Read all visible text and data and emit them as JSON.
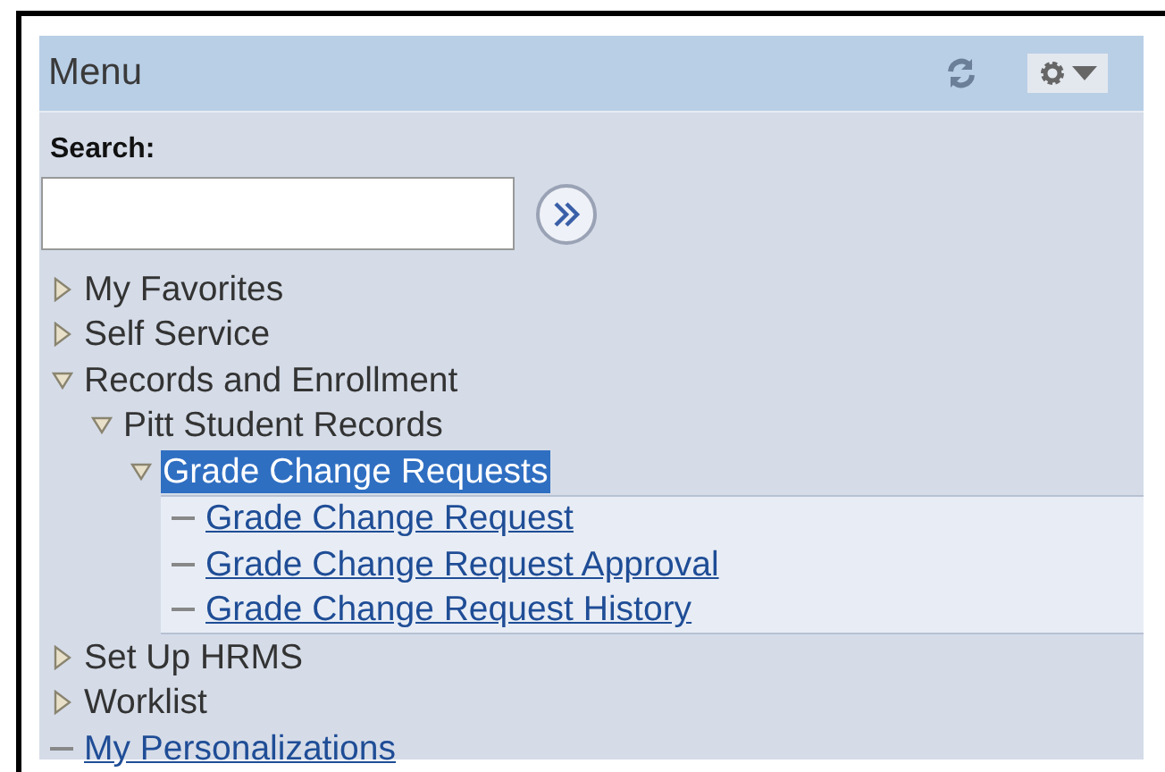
{
  "panel": {
    "title": "Menu"
  },
  "search": {
    "label": "Search:"
  },
  "tree": [
    {
      "label": "My Favorites",
      "kind": "folder",
      "expanded": false,
      "selected": false
    },
    {
      "label": "Self Service",
      "kind": "folder",
      "expanded": false,
      "selected": false
    },
    {
      "label": "Records and Enrollment",
      "kind": "folder",
      "expanded": true,
      "selected": false,
      "children": [
        {
          "label": "Pitt Student Records",
          "kind": "folder",
          "expanded": true,
          "selected": false,
          "children": [
            {
              "label": "Grade Change Requests",
              "kind": "folder",
              "expanded": true,
              "selected": true,
              "children": [
                {
                  "label": "Grade Change Request",
                  "kind": "link",
                  "selected": false
                },
                {
                  "label": "Grade Change Request Approval",
                  "kind": "link",
                  "selected": false
                },
                {
                  "label": "Grade Change Request History",
                  "kind": "link",
                  "selected": false
                }
              ]
            }
          ]
        }
      ]
    },
    {
      "label": "Set Up HRMS",
      "kind": "folder",
      "expanded": false,
      "selected": false
    },
    {
      "label": "Worklist",
      "kind": "folder",
      "expanded": false,
      "selected": false
    },
    {
      "label": "My Personalizations",
      "kind": "link",
      "selected": false
    }
  ]
}
